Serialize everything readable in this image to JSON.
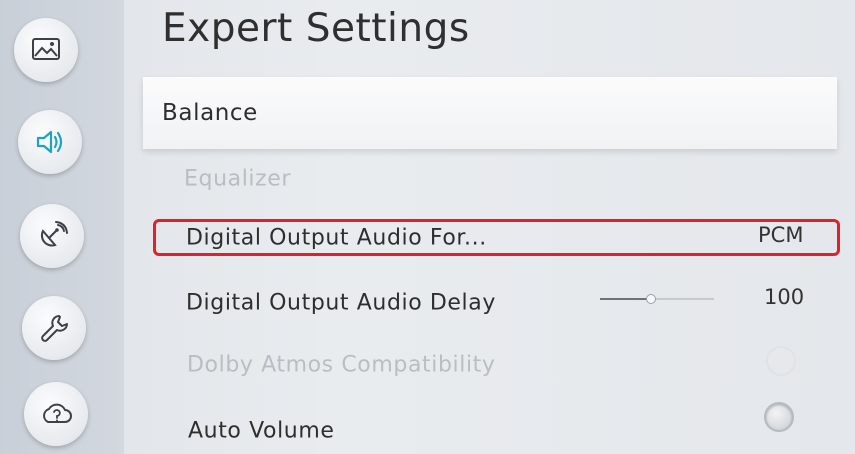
{
  "page": {
    "title": "Expert Settings"
  },
  "sidebar": {
    "items": [
      {
        "icon": "picture-icon"
      },
      {
        "icon": "sound-icon",
        "active": true
      },
      {
        "icon": "broadcasting-icon"
      },
      {
        "icon": "support-icon"
      },
      {
        "icon": "help-icon"
      }
    ]
  },
  "menu": {
    "balance": {
      "label": "Balance"
    },
    "equalizer": {
      "label": "Equalizer",
      "enabled": false
    },
    "digital_output_format": {
      "label": "Digital Output Audio For...",
      "value": "PCM"
    },
    "digital_output_delay": {
      "label": "Digital Output Audio Delay",
      "value": "100",
      "slider_fraction": 0.45
    },
    "dolby_atmos": {
      "label": "Dolby Atmos Compatibility",
      "enabled": false,
      "on": false
    },
    "auto_volume": {
      "label": "Auto Volume",
      "on": false
    }
  },
  "colors": {
    "highlight": "#e0202a",
    "sound_icon": "#1fa3c4"
  }
}
